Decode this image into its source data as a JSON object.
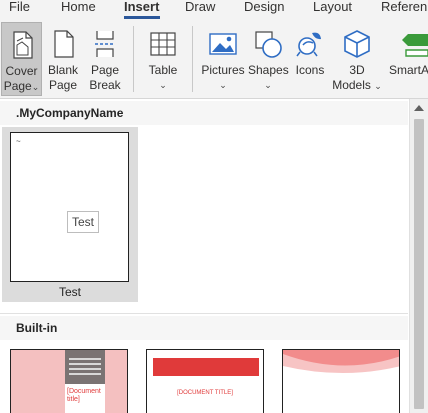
{
  "tabs": [
    {
      "label": "File"
    },
    {
      "label": "Home"
    },
    {
      "label": "Insert"
    },
    {
      "label": "Draw"
    },
    {
      "label": "Design"
    },
    {
      "label": "Layout"
    },
    {
      "label": "Referen"
    }
  ],
  "active_tab": "Insert",
  "ribbon": {
    "cover_page": {
      "line1": "Cover",
      "line2": "Page",
      "chevron": "⌄"
    },
    "blank_page": {
      "line1": "Blank",
      "line2": "Page"
    },
    "page_break": {
      "line1": "Page",
      "line2": "Break"
    },
    "table": {
      "line1": "Table",
      "chevron": "⌄"
    },
    "pictures": {
      "line1": "Pictures",
      "chevron": "⌄"
    },
    "shapes": {
      "line1": "Shapes",
      "chevron": "⌄"
    },
    "icons": {
      "line1": "Icons"
    },
    "models_3d": {
      "line1": "3D",
      "line2": "Models",
      "chevron": "⌄"
    },
    "smartart": {
      "line1": "SmartA"
    }
  },
  "gallery": {
    "section_custom": ".MyCompanyName",
    "custom_tile": {
      "caption": "Test",
      "tooltip": "Test",
      "mark": "~"
    },
    "section_builtin": "Built-in",
    "builtin_tiles": [
      {
        "name": "builtin-1",
        "title": "[Document",
        "subtitle": "title]"
      },
      {
        "name": "builtin-2",
        "title": "[DOCUMENT TITLE]"
      },
      {
        "name": "builtin-3",
        "title": ""
      }
    ]
  },
  "colors": {
    "ribbon_bg": "#f3f3f3",
    "accent_blue": "#2b579a",
    "icon_blue": "#2f6dc4",
    "builtin_red": "#e03a3a",
    "builtin_pink": "#f4c0c0"
  }
}
